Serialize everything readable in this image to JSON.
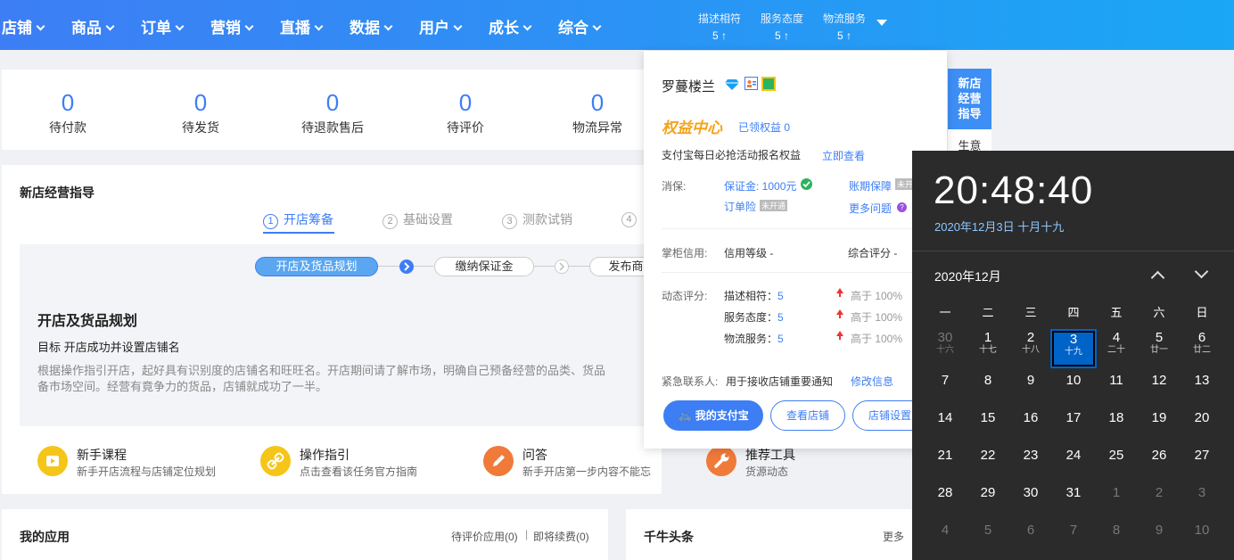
{
  "nav": {
    "items": [
      "店铺",
      "商品",
      "订单",
      "营销",
      "直播",
      "数据",
      "用户",
      "成长",
      "综合"
    ],
    "scores": [
      {
        "label": "描述相符",
        "value": "5 ↑"
      },
      {
        "label": "服务态度",
        "value": "5 ↑"
      },
      {
        "label": "物流服务",
        "value": "5 ↑"
      }
    ]
  },
  "stats": [
    {
      "num": "0",
      "label": "待付款"
    },
    {
      "num": "0",
      "label": "待发货"
    },
    {
      "num": "0",
      "label": "待退款售后"
    },
    {
      "num": "0",
      "label": "待评价"
    },
    {
      "num": "0",
      "label": "物流异常"
    }
  ],
  "guide_section": {
    "title": "新店经营指导",
    "steps": [
      {
        "no": "1",
        "label": "开店筹备"
      },
      {
        "no": "2",
        "label": "基础设置"
      },
      {
        "no": "3",
        "label": "测款试销"
      },
      {
        "no": "4",
        "label": ""
      }
    ],
    "pills": [
      "开店及货品规划",
      "缴纳保证金",
      "发布商"
    ],
    "plan_title": "开店及货品规划",
    "plan_goal": "目标 开店成功并设置店铺名",
    "plan_desc_1": "根据操作指引开店，起好具有识别度的店铺名和旺旺名。开店期间请了解市场，明确自己预备经营的品类、货品",
    "plan_desc_2": "备市场空间。经营有竟争力的货品，店铺就成功了一半。"
  },
  "tools": [
    {
      "title": "新手课程",
      "desc": "新手开店流程与店铺定位规划",
      "color": "#f5c518",
      "icon": "play-icon"
    },
    {
      "title": "操作指引",
      "desc": "点击查看该任务官方指南",
      "color": "#f5c518",
      "icon": "link-icon"
    },
    {
      "title": "问答",
      "desc": "新手开店第一步内容不能忘",
      "color": "#f07a3a",
      "icon": "pencil-icon"
    },
    {
      "title": "推荐工具",
      "desc": "货源动态",
      "color": "#f07a3a",
      "icon": "wrench-icon"
    }
  ],
  "apps": {
    "title": "我的应用",
    "pending": "待评价应用(0)",
    "renew": "即将续费(0)"
  },
  "news": {
    "title": "千牛头条",
    "more": "更多"
  },
  "popup": {
    "shop_name": "罗蔓楼兰",
    "rights_title": "权益中心",
    "rights_got": "已领权益 0",
    "alipay_text": "支付宝每日必抢活动报名权益",
    "view_now": "立即查看",
    "protect_label": "消保:",
    "deposit": "保证金: 1000元",
    "period_protect": "账期保障",
    "not_open_1": "未开",
    "order_insurance": "订单险",
    "not_open_2": "未开通",
    "more_questions": "更多问题",
    "credit_label": "掌柜信用:",
    "credit_level": "信用等级 -",
    "overall_score": "综合评分 -",
    "dynamic_label": "动态评分:",
    "ratings": [
      {
        "label": "描述相符：",
        "value": "5",
        "compare": "高于 100%"
      },
      {
        "label": "服务态度：",
        "value": "5",
        "compare": "高于 100%"
      },
      {
        "label": "物流服务：",
        "value": "5",
        "compare": "高于 100%"
      }
    ],
    "contact_label": "紧急联系人:",
    "contact_text": "用于接收店铺重要通知",
    "modify": "修改信息",
    "btn_alipay": "我的支付宝",
    "btn_view_shop": "查看店铺",
    "btn_settings": "店铺设置"
  },
  "side_guide": {
    "label": "新店经营指导",
    "label2": "生意"
  },
  "calendar": {
    "time": "20:48:40",
    "date": "2020年12月3日 十月十九",
    "month": "2020年12月",
    "weekdays": [
      "一",
      "二",
      "三",
      "四",
      "五",
      "六",
      "日"
    ],
    "days": [
      [
        {
          "n": "30",
          "l": "十六",
          "dim": true
        },
        {
          "n": "1",
          "l": "十七"
        },
        {
          "n": "2",
          "l": "十八"
        },
        {
          "n": "3",
          "l": "十九",
          "today": true
        },
        {
          "n": "4",
          "l": "二十"
        },
        {
          "n": "5",
          "l": "廿一"
        },
        {
          "n": "6",
          "l": "廿二"
        }
      ],
      [
        {
          "n": "7"
        },
        {
          "n": "8"
        },
        {
          "n": "9"
        },
        {
          "n": "10"
        },
        {
          "n": "11"
        },
        {
          "n": "12"
        },
        {
          "n": "13"
        }
      ],
      [
        {
          "n": "14"
        },
        {
          "n": "15"
        },
        {
          "n": "16"
        },
        {
          "n": "17"
        },
        {
          "n": "18"
        },
        {
          "n": "19"
        },
        {
          "n": "20"
        }
      ],
      [
        {
          "n": "21"
        },
        {
          "n": "22"
        },
        {
          "n": "23"
        },
        {
          "n": "24"
        },
        {
          "n": "25"
        },
        {
          "n": "26"
        },
        {
          "n": "27"
        }
      ],
      [
        {
          "n": "28"
        },
        {
          "n": "29"
        },
        {
          "n": "30"
        },
        {
          "n": "31"
        },
        {
          "n": "1",
          "dim": true
        },
        {
          "n": "2",
          "dim": true
        },
        {
          "n": "3",
          "dim": true
        }
      ],
      [
        {
          "n": "4",
          "dim": true
        },
        {
          "n": "5",
          "dim": true
        },
        {
          "n": "6",
          "dim": true
        },
        {
          "n": "7",
          "dim": true
        },
        {
          "n": "8",
          "dim": true
        },
        {
          "n": "9",
          "dim": true
        },
        {
          "n": "10",
          "dim": true
        }
      ]
    ]
  }
}
